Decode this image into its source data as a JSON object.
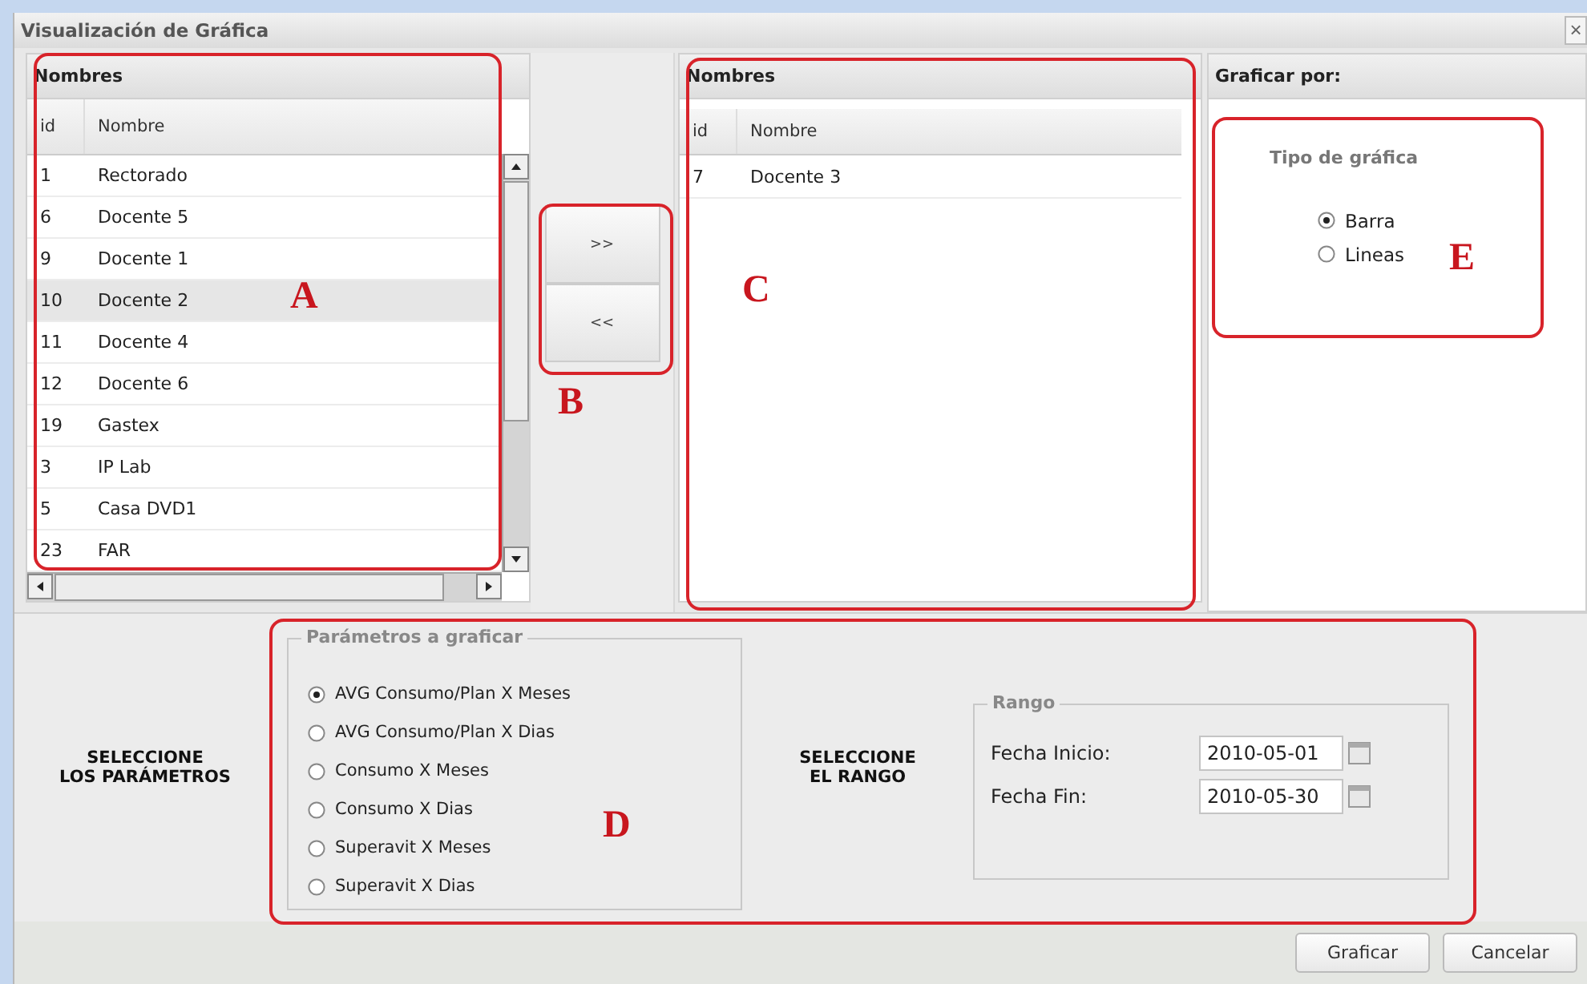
{
  "window": {
    "title": "Visualización de Gráfica",
    "close": "×"
  },
  "available": {
    "title": "Nombres",
    "columns": [
      "id",
      "Nombre"
    ],
    "rows": [
      {
        "id": "1",
        "name": "Rectorado",
        "selected": false
      },
      {
        "id": "6",
        "name": "Docente 5",
        "selected": false
      },
      {
        "id": "9",
        "name": "Docente 1",
        "selected": false
      },
      {
        "id": "10",
        "name": "Docente 2",
        "selected": true
      },
      {
        "id": "11",
        "name": "Docente 4",
        "selected": false
      },
      {
        "id": "12",
        "name": "Docente 6",
        "selected": false
      },
      {
        "id": "19",
        "name": "Gastex",
        "selected": false
      },
      {
        "id": "3",
        "name": "IP Lab",
        "selected": false
      },
      {
        "id": "5",
        "name": "Casa DVD1",
        "selected": false
      },
      {
        "id": "23",
        "name": "FAR",
        "selected": false
      }
    ]
  },
  "transfer_buttons": [
    ">>",
    "<<"
  ],
  "chosen": {
    "title": "Nombres",
    "columns": [
      "id",
      "Nombre"
    ],
    "rows": [
      {
        "id": "7",
        "name": "Docente 3",
        "selected": false
      }
    ]
  },
  "graph_by": {
    "title": "Graficar por:",
    "group_label": "Tipo de gráfica",
    "options": [
      {
        "label": "Barra",
        "checked": true
      },
      {
        "label": "Lineas",
        "checked": false
      }
    ]
  },
  "parameters": {
    "label": "SELECCIONE\nLOS PARÁMETROS",
    "legend": "Parámetros a graficar",
    "options": [
      {
        "label": "AVG Consumo/Plan X Meses",
        "checked": true
      },
      {
        "label": "AVG Consumo/Plan X Dias",
        "checked": false
      },
      {
        "label": "Consumo X Meses",
        "checked": false
      },
      {
        "label": "Consumo X Dias",
        "checked": false
      },
      {
        "label": "Superavit X Meses",
        "checked": false
      },
      {
        "label": "Superavit X Dias",
        "checked": false
      }
    ]
  },
  "range": {
    "label": "SELECCIONE\nEL RANGO",
    "legend": "Rango",
    "fields": [
      {
        "label": "Fecha Inicio:",
        "value": "2010-05-01"
      },
      {
        "label": "Fecha Fin:",
        "value": "2010-05-30"
      }
    ]
  },
  "buttons": [
    "Graficar",
    "Cancelar"
  ],
  "annotations": [
    {
      "label": "A"
    },
    {
      "label": "B"
    },
    {
      "label": "C"
    },
    {
      "label": "D"
    },
    {
      "label": "E"
    }
  ]
}
